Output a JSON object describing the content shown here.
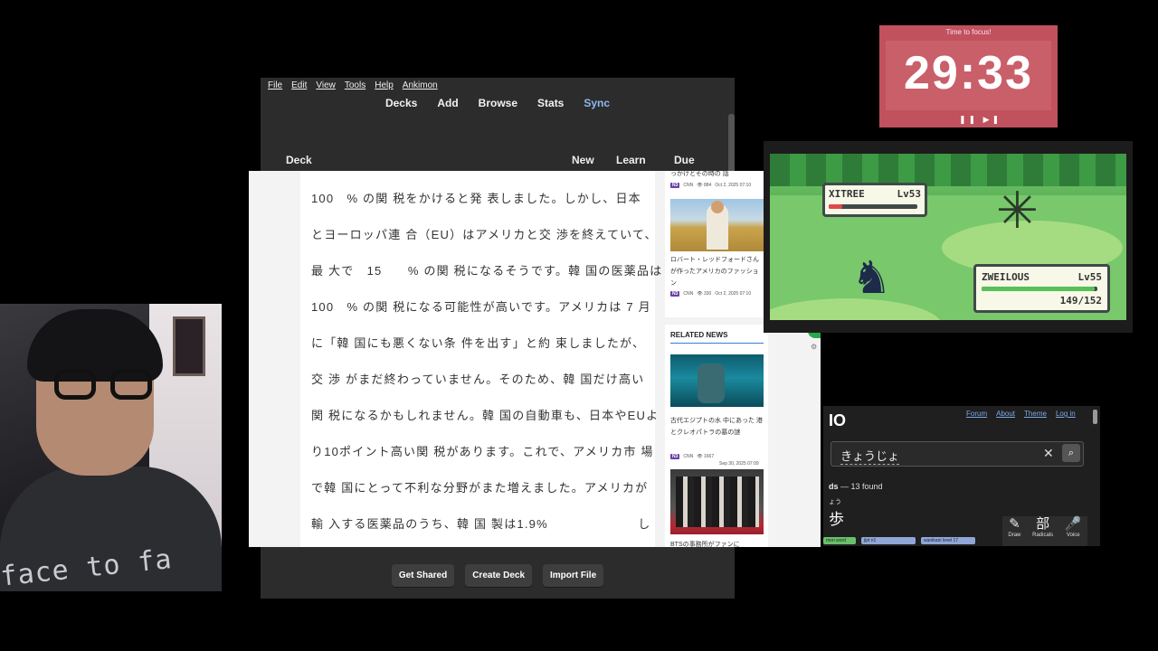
{
  "timer": {
    "label": "Time to focus!",
    "time": "29:33",
    "controls": "❚❚ ▶❚"
  },
  "webcam": {
    "shirt_text": "face to fa"
  },
  "anki": {
    "menu": [
      "File",
      "Edit",
      "View",
      "Tools",
      "Help",
      "Ankimon"
    ],
    "nav": {
      "decks": "Decks",
      "add": "Add",
      "browse": "Browse",
      "stats": "Stats",
      "sync": "Sync"
    },
    "columns": {
      "deck": "Deck",
      "new": "New",
      "learn": "Learn",
      "due": "Due"
    },
    "buttons": {
      "get_shared": "Get Shared",
      "create_deck": "Create Deck",
      "import_file": "Import File"
    }
  },
  "article": {
    "lines": [
      "100　% の関 税をかけると発 表しました。しかし、日本",
      "とヨーロッパ連 合（EU）はアメリカと交 渉を終えていて、",
      "最 大で　15　　% の関 税になるそうです。韓 国の医薬品は",
      "100　% の関 税になる可能性が高いです。アメリカは 7 月",
      "に「韓 国にも悪くない条 件を出す」と約 束しましたが、",
      "交 渉 がまだ終わっていません。そのため、韓 国だけ高い",
      "関 税になるかもしれません。韓 国の自動車も、日本やEUよ",
      "り10ポイント高い関 税があります。これで、アメリカ市 場",
      "で韓 国にとって不利な分野がまた増えました。アメリカが",
      "輸 入する医薬品のうち、韓 国 製は1.9%　　　　　　　し"
    ],
    "sidebar": {
      "item1_title_tail": "っかけとその時の 話",
      "item1_level": "N3",
      "item1_source": "CNN",
      "item1_views": "👁 884",
      "item1_date": "Oct 2, 2025 07:10",
      "item2_title": "ロバート・レッドフォードさんが作ったアメリカのファッション",
      "item2_level": "N3",
      "item2_source": "CNN",
      "item2_views": "👁 330",
      "item2_date": "Oct 2, 2025 07:10",
      "related_title": "RELATED NEWS",
      "item3_title": "古代エジプトの水 中にあった 港 とクレオパトラの墓の謎",
      "item3_level": "N3",
      "item3_source": "CNN",
      "item3_views": "👁 1667",
      "item3_date": "Sep 30, 2025 07:09",
      "item4_title_head": "BTSの事務所がファンに"
    }
  },
  "pokemon": {
    "enemy_name": "XITREE",
    "enemy_level": "Lv53",
    "enemy_hp_fraction": 0.15,
    "player_name": "ZWEILOUS",
    "player_level": "Lv55",
    "player_hp": "149/152",
    "player_hp_fraction": 0.98
  },
  "jisho": {
    "logo": "IO",
    "links": [
      "Forum",
      "About",
      "Theme",
      "Log in"
    ],
    "query": "きょうじょ",
    "found_label": "ds",
    "found_count": "— 13 found",
    "furigana": "ょう",
    "kanji": "歩",
    "tags": [
      "mon word",
      "jlpt n1",
      "wanikani level 17"
    ],
    "tools": [
      {
        "icon": "✎",
        "label": "Draw"
      },
      {
        "icon": "部",
        "label": "Radicals"
      },
      {
        "icon": "🎤",
        "label": "Voice"
      }
    ]
  },
  "colors": {
    "timer_bg": "#c0515d",
    "sync_link": "#8fb8ef",
    "jlpt_tag": "#8fa6d6"
  }
}
